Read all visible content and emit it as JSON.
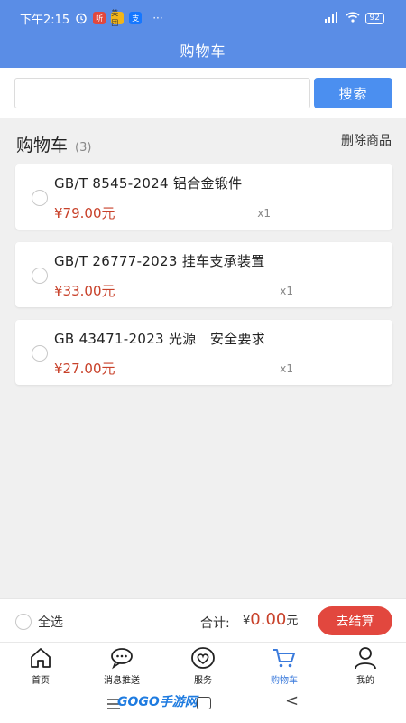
{
  "status_bar": {
    "time": "下午2:15",
    "battery": "92",
    "badges": [
      "听",
      "美团",
      "支"
    ],
    "more": "···"
  },
  "page_title": "购物车",
  "search": {
    "value": "",
    "placeholder": "",
    "button_label": "搜索"
  },
  "cart": {
    "heading": "购物车",
    "count": "(3)",
    "delete_label": "删除商品",
    "items": [
      {
        "name": "GB/T 8545-2024 铝合金锻件",
        "price": "¥79.00元",
        "qty": "x1",
        "selected": false
      },
      {
        "name": "GB/T 26777-2023 挂车支承装置",
        "price": "¥33.00元",
        "qty": "x1",
        "selected": false
      },
      {
        "name": "GB 43471-2023 光源　安全要求",
        "price": "¥27.00元",
        "qty": "x1",
        "selected": false
      }
    ]
  },
  "footer": {
    "select_all": "全选",
    "total_label": "合计:",
    "currency": "¥",
    "total_value": "0.00",
    "total_unit": "元",
    "checkout": "去结算"
  },
  "tabs": [
    {
      "label": "首页",
      "icon": "home-icon",
      "active": false
    },
    {
      "label": "消息推送",
      "icon": "message-icon",
      "active": false
    },
    {
      "label": "服务",
      "icon": "heart-icon",
      "active": false
    },
    {
      "label": "购物车",
      "icon": "cart-icon",
      "active": true
    },
    {
      "label": "我的",
      "icon": "person-icon",
      "active": false
    }
  ],
  "watermark": "GOGO手游网",
  "colors": {
    "header": "#5a8de6",
    "accent": "#4b8ff0",
    "price": "#c8412a",
    "checkout": "#e2473e",
    "active_tab": "#3b7bdc"
  }
}
